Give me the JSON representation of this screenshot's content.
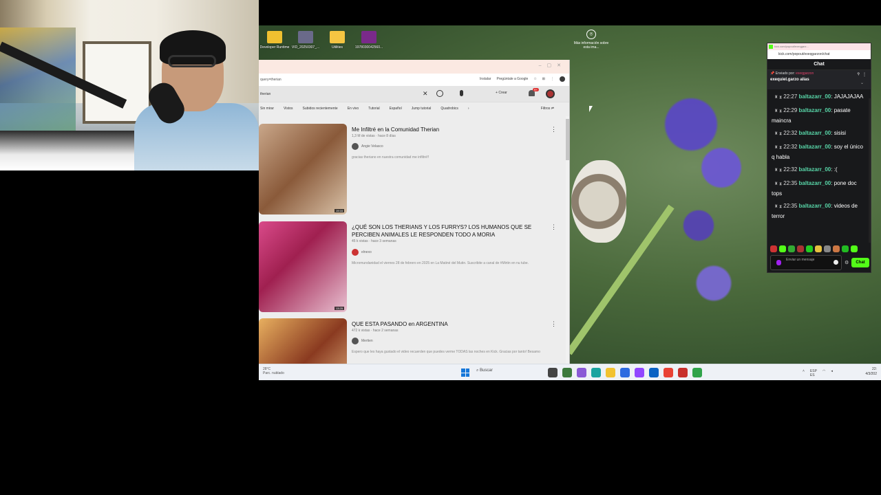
{
  "desktop": {
    "icons": [
      {
        "label": "Developer Runtime",
        "color": "#f0c030"
      },
      {
        "label": "VID_20250307_...",
        "color": "#6a6a8a"
      },
      {
        "label": "Utilities",
        "color": "#f5c542"
      },
      {
        "label": "1978030042560...",
        "color": "#7a2a8a"
      }
    ],
    "more_info": "Más información sobre esta ima..."
  },
  "browser": {
    "url": "query=therian",
    "address_actions": {
      "install": "Instalar",
      "ask_google": "Pregúntale a Google"
    },
    "search_query": "therian",
    "create_label": "Crear",
    "notification_count": "9+",
    "chips": [
      "Sin mirar",
      "Vistos",
      "Subidos recientemente",
      "En vivo",
      "Tutorial",
      "Español",
      "Jump tutorial",
      "Quadrobics"
    ],
    "filters_label": "Filtros",
    "videos": [
      {
        "title": "Me Infiltré en la Comunidad Therian",
        "meta": "1,3 M de vistas · hace 8 días",
        "channel": "Angie Velasco",
        "desc": "gracias theriano en nuestra comunidad me infiltré!!",
        "duration": "19:16"
      },
      {
        "title": "¿QUÉ SON LOS THERIANS Y LOS FURRYS? LOS HUMANOS QUE SE PERCIBEN ANIMALES LE RESPONDEN TODO A MORIA",
        "meta": "45 k vistas · hace 3 semanas",
        "channel": "elnexo",
        "desc": "Micromundanidad el viernes 28 de febrero en 2025 en La Matiné del Mutin. Suscribite a canal de #Mirtin en nu tube.",
        "duration": "13:25"
      },
      {
        "title": "QUE ESTA PASANDO en ARGENTINA",
        "meta": "472 k vistas · hace 2 semanas",
        "channel": "Mertien",
        "desc": "Espero que les haya gustado el video recuerden que puedes verme TODAS las noches en Kick. Gracias por tanto! Besamo",
        "duration": ""
      }
    ]
  },
  "taskbar": {
    "weather_temp": "28°C",
    "weather_desc": "Parc. nublado",
    "search_label": "Buscar",
    "lang": "ESP",
    "lang_region": "ES",
    "clock_time": "22:",
    "clock_date": "4/3/202"
  },
  "chat": {
    "browser_url_short": "kick.com/popout/exeqgarz...",
    "url": "kick.com/popout/exeqgarzon/chat",
    "title": "Chat",
    "pinned_by_label": "Enviado por",
    "pinned_by_user": "exeqgarzon",
    "pinned_alias": "exequiel.garzo alias",
    "messages": [
      {
        "time": "22:27",
        "user": "baltazarr_00",
        "text": "JAJAJAJAA"
      },
      {
        "time": "22:29",
        "user": "baltazarr_00",
        "text": "pasate maincra"
      },
      {
        "time": "22:32",
        "user": "baltazarr_00",
        "text": "sisisi"
      },
      {
        "time": "22:32",
        "user": "baltazarr_00",
        "text": "soy el único q habla"
      },
      {
        "time": "22:32",
        "user": "baltazarr_00",
        "text": ":("
      },
      {
        "time": "22:35",
        "user": "baltazarr_00",
        "text": "pone doc tops"
      },
      {
        "time": "22:35",
        "user": "baltazarr_00",
        "text": "videos de terror"
      }
    ],
    "input_placeholder": "Enviar un mensaje",
    "send_label": "Chat",
    "brand_color": "#53fc18"
  }
}
